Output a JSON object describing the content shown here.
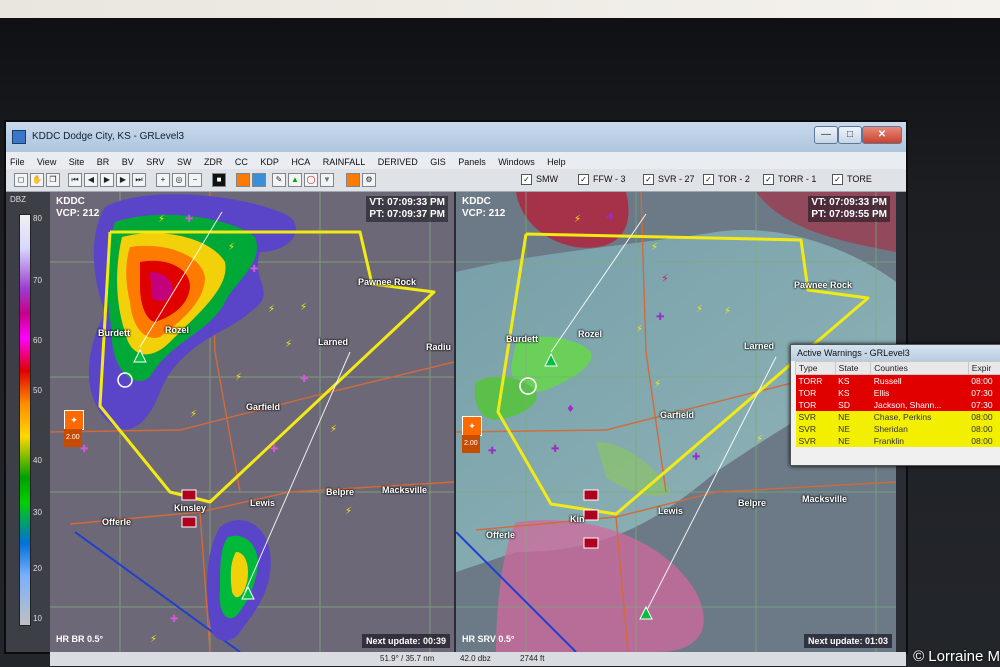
{
  "window": {
    "title": "KDDC Dodge City, KS - GRLevel3",
    "controls": [
      "—",
      "□",
      "✕"
    ]
  },
  "menu": [
    "File",
    "View",
    "Site",
    "BR",
    "BV",
    "SRV",
    "SW",
    "ZDR",
    "CC",
    "KDP",
    "HCA",
    "RAINFALL",
    "DERIVED",
    "GIS",
    "Panels",
    "Windows",
    "Help"
  ],
  "warnings_toggles": [
    {
      "label": "SMW",
      "checked": true
    },
    {
      "label": "FFW - 3",
      "checked": true
    },
    {
      "label": "SVR - 27",
      "checked": true
    },
    {
      "label": "TOR - 2",
      "checked": true
    },
    {
      "label": "TORR - 1",
      "checked": true
    },
    {
      "label": "TORE",
      "checked": true
    }
  ],
  "colorbar": {
    "unit": "DBZ",
    "ticks": [
      "80",
      "70",
      "60",
      "50",
      "40",
      "30",
      "20",
      "10"
    ]
  },
  "left_panel": {
    "site": "KDDC",
    "vcp": "VCP: 212",
    "vt": "VT: 07:09:33 PM",
    "pt": "PT: 07:09:37 PM",
    "product": "HR BR 0.5°",
    "next_update": "Next update: 00:39",
    "tile_label": "2.00"
  },
  "right_panel": {
    "site": "KDDC",
    "vcp": "VCP: 212",
    "vt": "VT: 07:09:33 PM",
    "pt": "PT: 07:09:55 PM",
    "product": "HR SRV 0.5°",
    "next_update": "Next update: 01:03",
    "tile_label": "2.00"
  },
  "cities": {
    "pawnee_rock": "Pawnee Rock",
    "burdett": "Burdett",
    "rozel": "Rozel",
    "larned": "Larned",
    "radium": "Radiu",
    "garfield": "Garfield",
    "lewis": "Lewis",
    "belpre": "Belpre",
    "macksville": "Macksville",
    "offerle": "Offerle",
    "kinsley": "Kinsley",
    "kin": "Kin"
  },
  "status": {
    "left": "51.9° / 35.7 nm",
    "mid": "42.0 dbz",
    "right": "2744 ft"
  },
  "active_warnings": {
    "title": "Active Warnings - GRLevel3",
    "columns": [
      "Type",
      "State",
      "Counties",
      "Expir"
    ],
    "rows": [
      {
        "type": "TORR",
        "state": "KS",
        "counties": "Russell",
        "expires": "08:00",
        "level": "torr"
      },
      {
        "type": "TOR",
        "state": "KS",
        "counties": "Ellis",
        "expires": "07:30",
        "level": "torr"
      },
      {
        "type": "TOR",
        "state": "SD",
        "counties": "Jackson, Shann...",
        "expires": "07:30",
        "level": "torr"
      },
      {
        "type": "SVR",
        "state": "NE",
        "counties": "Chase, Perkins",
        "expires": "08:00",
        "level": "svr"
      },
      {
        "type": "SVR",
        "state": "NE",
        "counties": "Sheridan",
        "expires": "08:00",
        "level": "svr"
      },
      {
        "type": "SVR",
        "state": "NE",
        "counties": "Franklin",
        "expires": "08:00",
        "level": "svr"
      }
    ]
  },
  "copyright": "© Lorraine M",
  "colors": {
    "warning_polygon": "#f2ea14",
    "torr": "#e00000",
    "svr": "#f2ef00"
  }
}
